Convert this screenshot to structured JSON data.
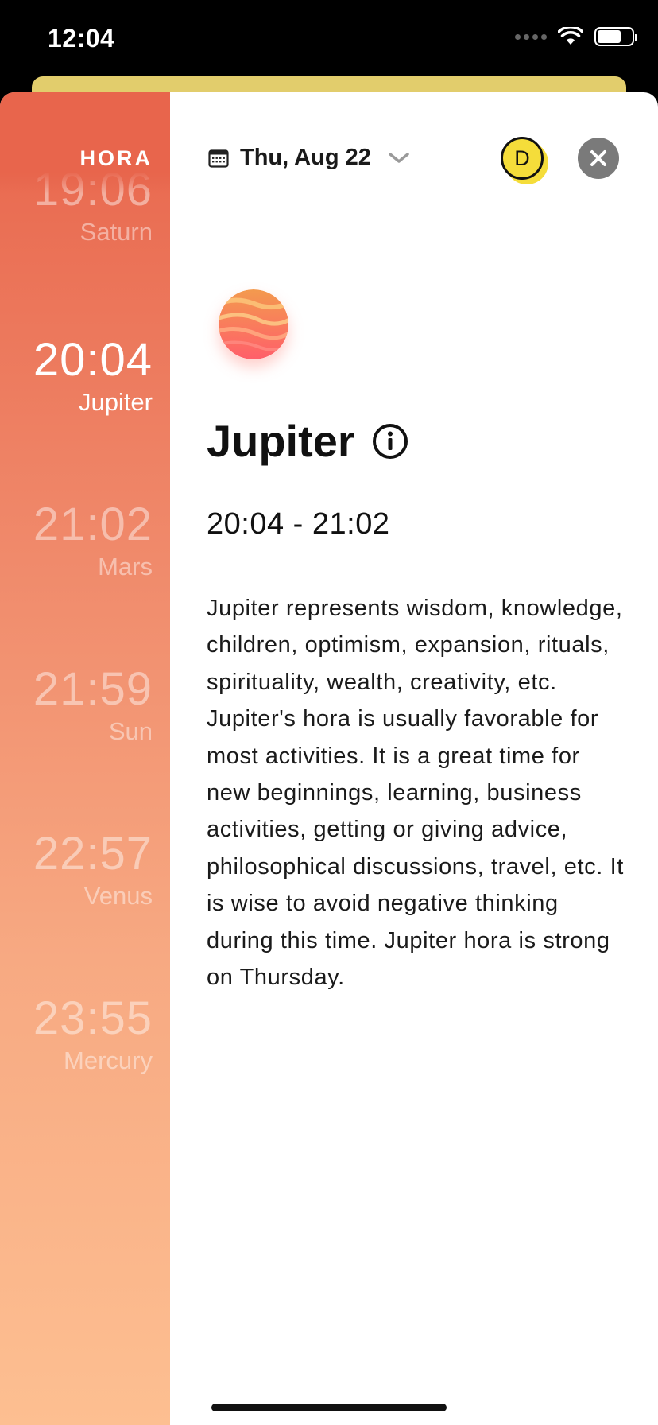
{
  "status_bar": {
    "time": "12:04"
  },
  "sidebar": {
    "title": "HORA",
    "items": [
      {
        "time": "19:06",
        "planet": "Saturn",
        "active": false
      },
      {
        "time": "20:04",
        "planet": "Jupiter",
        "active": true
      },
      {
        "time": "21:02",
        "planet": "Mars",
        "active": false
      },
      {
        "time": "21:59",
        "planet": "Sun",
        "active": false
      },
      {
        "time": "22:57",
        "planet": "Venus",
        "active": false
      },
      {
        "time": "23:55",
        "planet": "Mercury",
        "active": false
      }
    ]
  },
  "header": {
    "date": "Thu, Aug 22",
    "avatar_letter": "D"
  },
  "detail": {
    "planet_name": "Jupiter",
    "time_range": "20:04 - 21:02",
    "description": "Jupiter represents wisdom, knowledge, children, optimism, expansion, rituals, spirituality, wealth, creativity, etc. Jupiter's hora is usually favorable for most activities. It is a great time for new beginnings, learning, business activities, getting or giving advice, philosophical discussions, travel, etc. It is wise to avoid negative thinking during this time. Jupiter hora is strong on Thursday."
  },
  "icons": {
    "calendar": "calendar-icon",
    "chevron": "chevron-down-icon",
    "close": "close-icon",
    "info": "info-icon",
    "planet": "jupiter-planet-icon"
  },
  "colors": {
    "sidebar_top": "#e8654c",
    "sidebar_bottom": "#fdbf91",
    "avatar": "#f5dd3a",
    "close_button": "#7a7a7a",
    "sheet_behind": "#e2cd6c"
  }
}
